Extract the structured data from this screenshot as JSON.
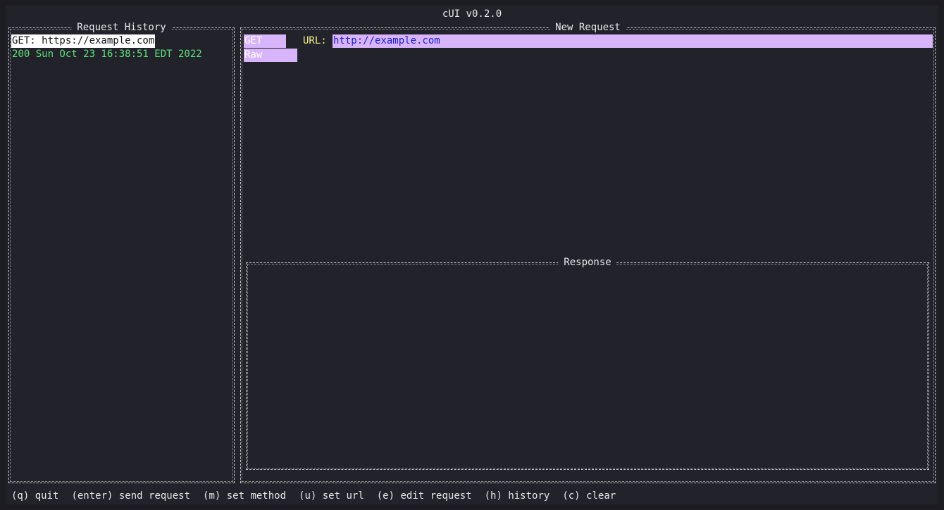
{
  "app": {
    "title": "cUI v0.2.0"
  },
  "history": {
    "title": "Request History",
    "items": [
      {
        "title": "GET: https://example.com",
        "status": "200 Sun Oct 23 16:38:51 EDT 2022"
      }
    ]
  },
  "request": {
    "title": "New Request",
    "method": "GET",
    "url_label": "URL:",
    "url": "http://example.com",
    "format": "Raw"
  },
  "response": {
    "title": "Response",
    "body": ""
  },
  "footer": {
    "shortcuts": [
      "(q) quit",
      "(enter) send request",
      "(m) set method",
      "(u) set url",
      "(e) edit request",
      "(h) history",
      "(c) clear"
    ]
  },
  "colors": {
    "background": "#22222b",
    "highlight": "#d8b4fa",
    "status_ok": "#5ee07a",
    "label_yellow": "#f4ee8c",
    "url_text": "#1e1ec8"
  }
}
